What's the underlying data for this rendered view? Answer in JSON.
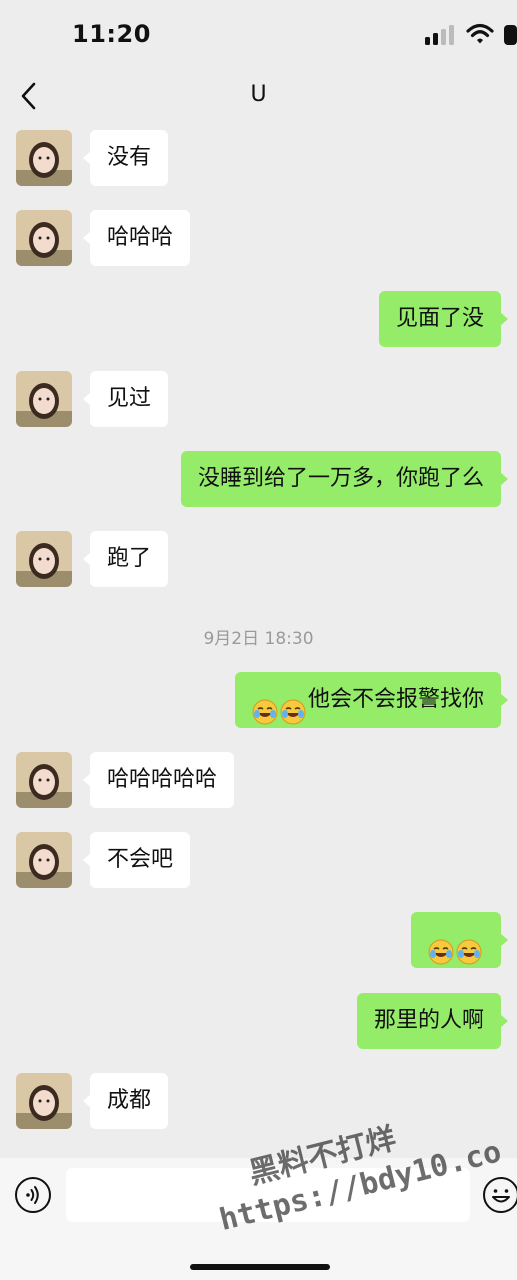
{
  "status_bar": {
    "time": "11:20"
  },
  "nav": {
    "title": "U"
  },
  "messages": [
    {
      "side": "left",
      "text": "没有"
    },
    {
      "side": "left",
      "text": "哈哈哈"
    },
    {
      "side": "right",
      "text": "见面了没"
    },
    {
      "side": "left",
      "text": "见过"
    },
    {
      "side": "right",
      "text": "没睡到给了一万多，你跑了么"
    },
    {
      "side": "left",
      "text": "跑了"
    },
    {
      "side": "right",
      "text": "他会不会报警找你",
      "emoji_prefix": [
        "face-with-tears-of-joy-icon",
        "face-with-tears-of-joy-icon"
      ]
    },
    {
      "side": "left",
      "text": "哈哈哈哈哈"
    },
    {
      "side": "left",
      "text": "不会吧"
    },
    {
      "side": "right",
      "text": "",
      "emoji_prefix": [
        "face-with-tears-of-joy-icon",
        "face-with-tears-of-joy-icon"
      ]
    },
    {
      "side": "right",
      "text": "那里的人啊"
    },
    {
      "side": "left",
      "text": "成都"
    }
  ],
  "timestamp": "9月2日 18:30",
  "input": {
    "value": "",
    "placeholder": ""
  },
  "watermark": {
    "line1": "黑料不打烊",
    "line2": "https://bdy10.co"
  },
  "colors": {
    "background": "#ededed",
    "bubble_mine": "#95ec69",
    "bubble_other": "#ffffff",
    "timestamp": "#9a9a9a"
  }
}
